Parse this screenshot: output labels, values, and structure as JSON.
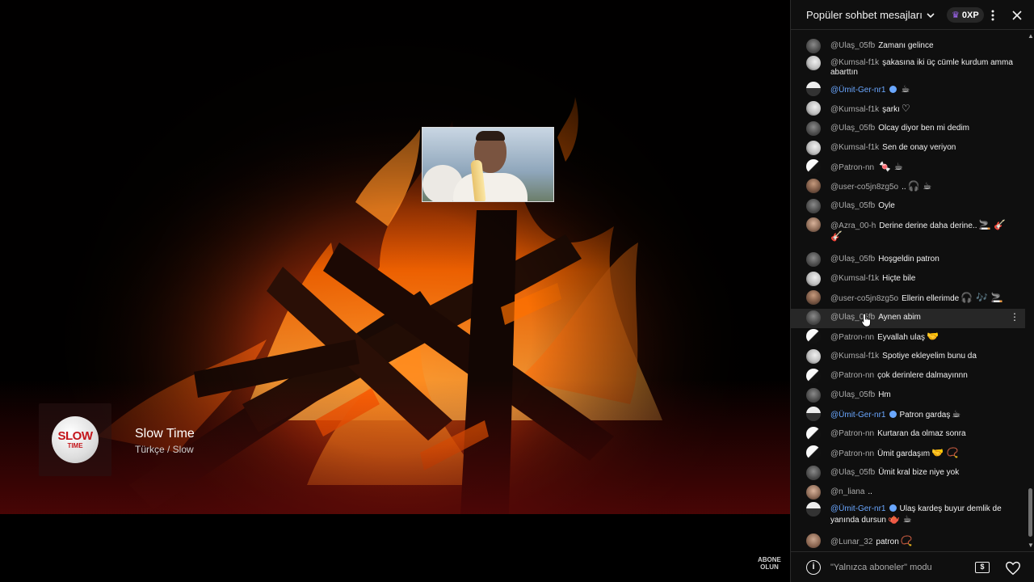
{
  "video": {
    "track_title": "Slow Time",
    "track_subtitle": "Türkçe / Slow",
    "channel_logo_line1": "SLOW",
    "channel_logo_line2": "TIME",
    "subscribe_watermark_line1": "ABONE",
    "subscribe_watermark_line2": "OLUN"
  },
  "chat": {
    "title": "Popüler sohbet mesajları",
    "points": "0XP",
    "footer_mode": "\"Yalnızca aboneler\" modu",
    "messages": [
      {
        "user": "@Ulaş_05fb",
        "text": "Zamanı gelince",
        "emoji": "",
        "owner": false,
        "avatar": "a-gray"
      },
      {
        "user": "@Kumsal-f1k",
        "text": "şakasına iki üç cümle kurdum amma abarttın",
        "emoji": "",
        "owner": false,
        "avatar": "a-white"
      },
      {
        "user": "@Ümit-Ger-nr1",
        "text": "",
        "emoji": "☕",
        "owner": true,
        "avatar": "a-flag"
      },
      {
        "user": "@Kumsal-f1k",
        "text": "şarkı",
        "emoji": "♡",
        "owner": false,
        "avatar": "a-white"
      },
      {
        "user": "@Ulaş_05fb",
        "text": "Olcay diyor ben mi dedim",
        "emoji": "",
        "owner": false,
        "avatar": "a-gray"
      },
      {
        "user": "@Kumsal-f1k",
        "text": "Sen de onay veriyon",
        "emoji": "",
        "owner": false,
        "avatar": "a-white"
      },
      {
        "user": "@Patron-nn",
        "text": "",
        "emoji": "🍬 ☕",
        "owner": false,
        "avatar": "a-bw"
      },
      {
        "user": "@user-co5jn8zg5o",
        "text": "..",
        "emoji": "🎧 ☕",
        "owner": false,
        "avatar": "a-person"
      },
      {
        "user": "@Ulaş_05fb",
        "text": "Oyle",
        "emoji": "",
        "owner": false,
        "avatar": "a-gray"
      },
      {
        "user": "@Azra_00-h",
        "text": "Derine derine daha derine..",
        "emoji": "🚬 🎸 🎸",
        "owner": false,
        "avatar": "a-girl"
      },
      {
        "user": "@Ulaş_05fb",
        "text": "Hoşgeldin patron",
        "emoji": "",
        "owner": false,
        "avatar": "a-gray"
      },
      {
        "user": "@Kumsal-f1k",
        "text": "Hiçte bile",
        "emoji": "",
        "owner": false,
        "avatar": "a-white"
      },
      {
        "user": "@user-co5jn8zg5o",
        "text": "Ellerin ellerimde",
        "emoji": "🎧 🎶 🚬",
        "owner": false,
        "avatar": "a-person"
      },
      {
        "user": "@Ulaş_05fb",
        "text": "Aynen abim",
        "emoji": "",
        "owner": false,
        "avatar": "a-gray"
      },
      {
        "user": "@Patron-nn",
        "text": "Eyvallah ulaş",
        "emoji": "🤝",
        "owner": false,
        "avatar": "a-bw"
      },
      {
        "user": "@Kumsal-f1k",
        "text": "Spotiye ekleyelim bunu da",
        "emoji": "",
        "owner": false,
        "avatar": "a-white"
      },
      {
        "user": "@Patron-nn",
        "text": "çok derinlere dalmayınnn",
        "emoji": "",
        "owner": false,
        "avatar": "a-bw"
      },
      {
        "user": "@Ulaş_05fb",
        "text": "Hm",
        "emoji": "",
        "owner": false,
        "avatar": "a-gray"
      },
      {
        "user": "@Ümit-Ger-nr1",
        "text": "Patron gardaş",
        "emoji": "☕",
        "owner": true,
        "avatar": "a-flag"
      },
      {
        "user": "@Patron-nn",
        "text": "Kurtaran da olmaz sonra",
        "emoji": "",
        "owner": false,
        "avatar": "a-bw"
      },
      {
        "user": "@Patron-nn",
        "text": "Ümit gardaşım",
        "emoji": "🤝 📿",
        "owner": false,
        "avatar": "a-bw"
      },
      {
        "user": "@Ulaş_05fb",
        "text": "Ümit kral bize niye yok",
        "emoji": "",
        "owner": false,
        "avatar": "a-gray"
      },
      {
        "user": "@n_liana",
        "text": "..",
        "emoji": "",
        "owner": false,
        "avatar": "a-girl"
      },
      {
        "user": "@Ümit-Ger-nr1",
        "text": "Ulaş kardeş buyur demlik de yanında dursun",
        "emoji": "🫖 ☕",
        "owner": true,
        "avatar": "a-flag"
      },
      {
        "user": "@Lunar_32",
        "text": "patron",
        "emoji": "📿",
        "owner": false,
        "avatar": "a-lunar"
      }
    ]
  }
}
